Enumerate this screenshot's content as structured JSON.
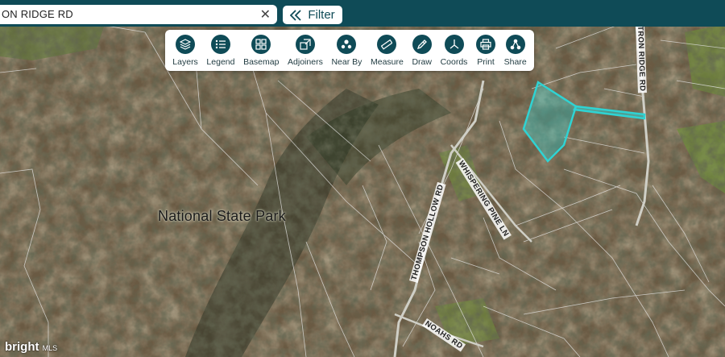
{
  "search": {
    "value": "ON RIDGE RD"
  },
  "filter": {
    "label": "Filter"
  },
  "toolbar": {
    "items": [
      {
        "label": "Layers",
        "icon": "layers-icon"
      },
      {
        "label": "Legend",
        "icon": "legend-icon"
      },
      {
        "label": "Basemap",
        "icon": "basemap-icon"
      },
      {
        "label": "Adjoiners",
        "icon": "adjoiners-icon"
      },
      {
        "label": "Near By",
        "icon": "near-by-icon"
      },
      {
        "label": "Measure",
        "icon": "measure-icon"
      },
      {
        "label": "Draw",
        "icon": "draw-icon"
      },
      {
        "label": "Coords",
        "icon": "coords-icon"
      },
      {
        "label": "Print",
        "icon": "print-icon"
      },
      {
        "label": "Share",
        "icon": "share-icon"
      }
    ]
  },
  "map": {
    "area_label": "National State Park",
    "roads": {
      "iron_ridge": "TRON RIDGE RD",
      "whispering_pine": "WHISPERING PINE LN",
      "thompson_hollow": "THOMPSON HOLLOW RD",
      "noahs": "NOAHS RD"
    },
    "parcel_color": "#2fd3d3"
  },
  "watermark": {
    "brand": "bright",
    "suffix": "MLS"
  }
}
